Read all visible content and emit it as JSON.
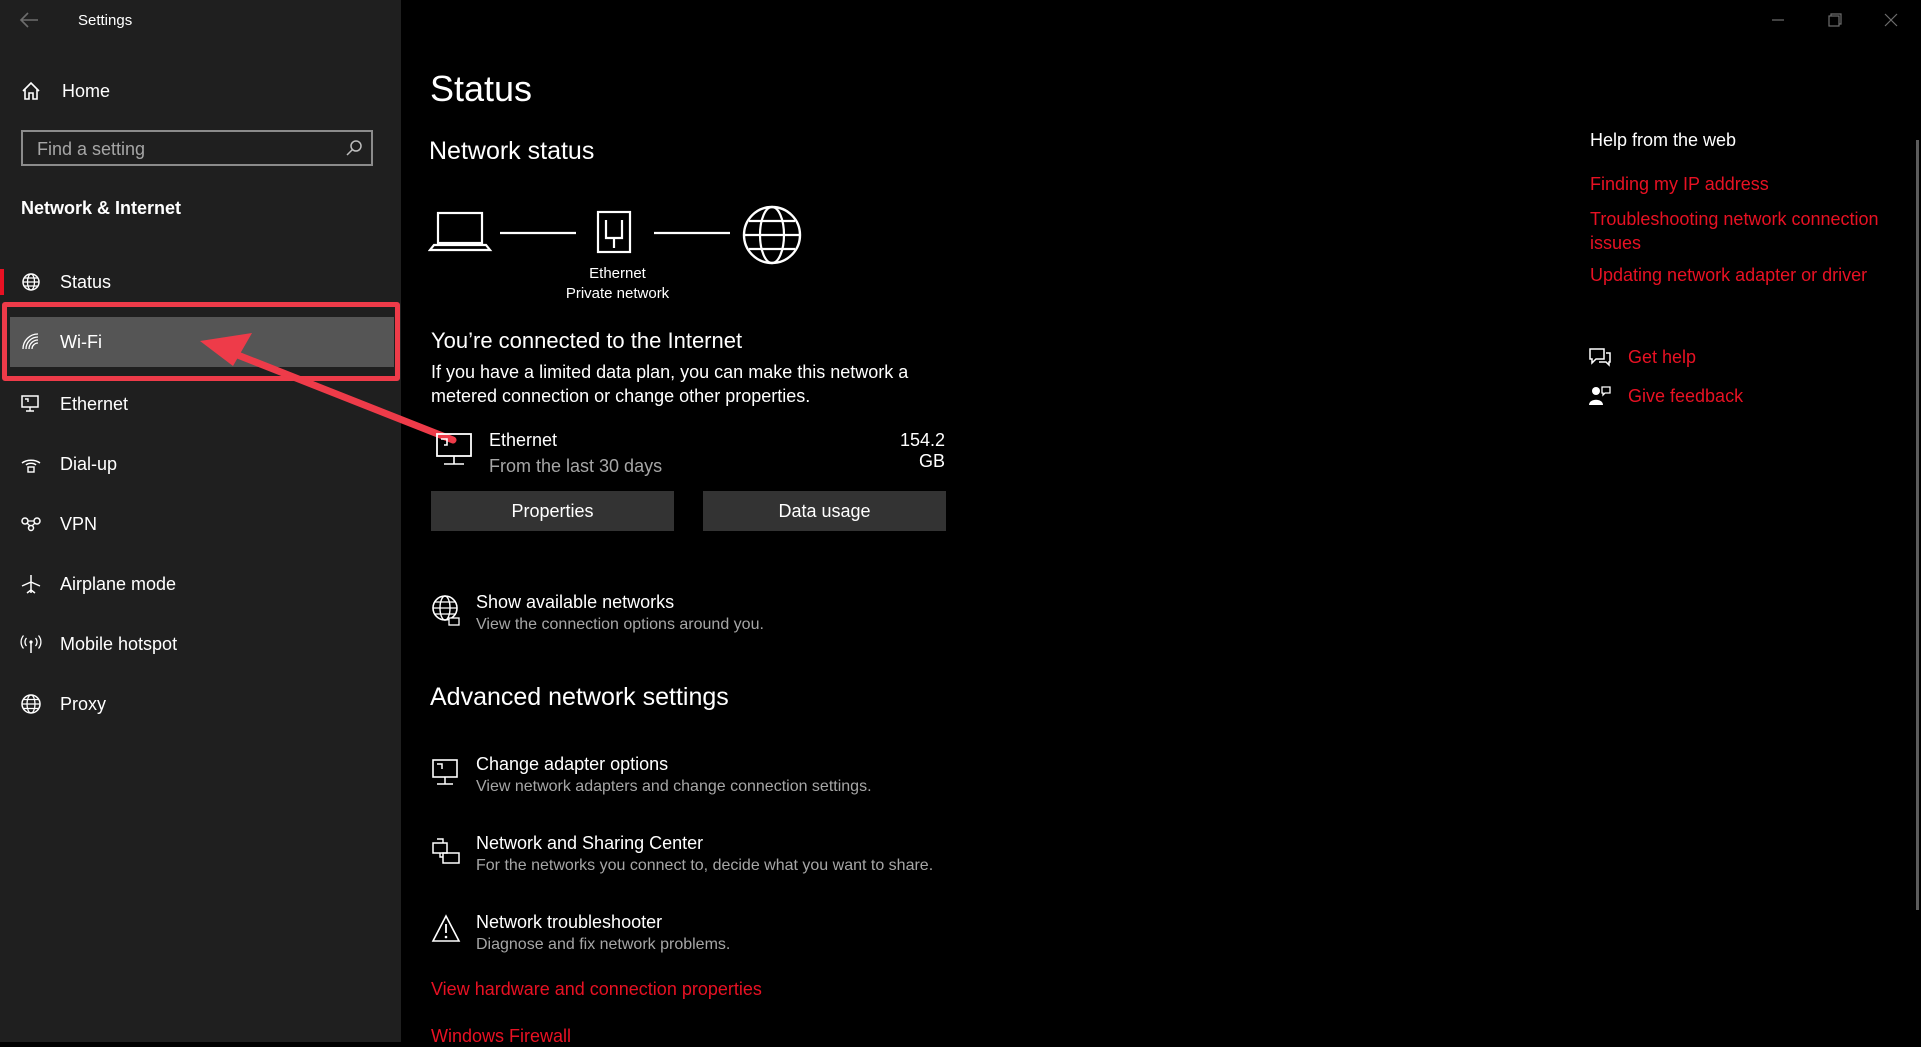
{
  "window": {
    "title": "Settings",
    "back_icon": "arrow-left-icon",
    "minimize_icon": "minimize-icon",
    "maximize_icon": "restore-icon",
    "close_icon": "close-icon"
  },
  "sidebar": {
    "home_label": "Home",
    "search_placeholder": "Find a setting",
    "section_title": "Network & Internet",
    "items": [
      {
        "label": "Status",
        "icon": "globe-network-icon",
        "selected": true
      },
      {
        "label": "Wi-Fi",
        "icon": "wifi-icon",
        "highlighted": true
      },
      {
        "label": "Ethernet",
        "icon": "ethernet-icon"
      },
      {
        "label": "Dial-up",
        "icon": "dialup-icon"
      },
      {
        "label": "VPN",
        "icon": "vpn-icon"
      },
      {
        "label": "Airplane mode",
        "icon": "airplane-icon"
      },
      {
        "label": "Mobile hotspot",
        "icon": "hotspot-icon"
      },
      {
        "label": "Proxy",
        "icon": "globe-icon"
      }
    ]
  },
  "main": {
    "title": "Status",
    "network_status_heading": "Network status",
    "diagram": {
      "adapter_name": "Ethernet",
      "network_type": "Private network"
    },
    "connected_heading": "You’re connected to the Internet",
    "connected_desc_line1": "If you have a limited data plan, you can make this network a",
    "connected_desc_line2": "metered connection or change other properties.",
    "usage": {
      "name": "Ethernet",
      "period": "From the last 30 days",
      "amount": "154.2 GB"
    },
    "buttons": {
      "properties": "Properties",
      "data_usage": "Data usage"
    },
    "show_networks": {
      "title": "Show available networks",
      "desc": "View the connection options around you."
    },
    "advanced_heading": "Advanced network settings",
    "advanced_items": [
      {
        "title": "Change adapter options",
        "desc": "View network adapters and change connection settings.",
        "icon": "adapter-icon"
      },
      {
        "title": "Network and Sharing Center",
        "desc": "For the networks you connect to, decide what you want to share.",
        "icon": "sharing-center-icon"
      },
      {
        "title": "Network troubleshooter",
        "desc": "Diagnose and fix network problems.",
        "icon": "warning-icon"
      }
    ],
    "links": {
      "hardware": "View hardware and connection properties",
      "firewall": "Windows Firewall"
    }
  },
  "help": {
    "heading": "Help from the web",
    "links": [
      "Finding my IP address",
      "Troubleshooting network connection issues",
      "Updating network adapter or driver"
    ],
    "get_help": "Get help",
    "give_feedback": "Give feedback"
  },
  "colors": {
    "accent": "#e81123",
    "sidebar_bg": "#1f1f1f",
    "annotation": "#ee3b49"
  }
}
